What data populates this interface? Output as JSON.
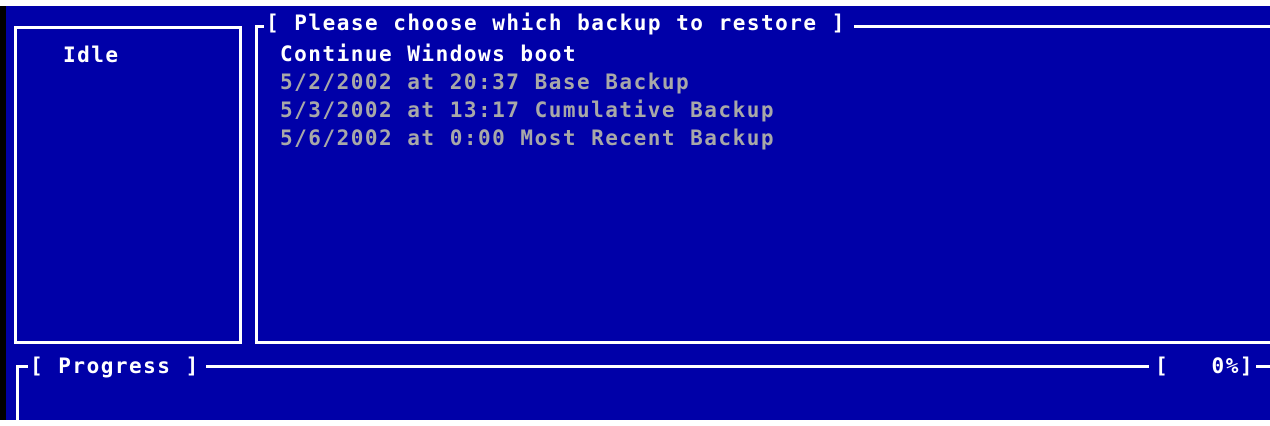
{
  "status": {
    "text": "Idle"
  },
  "restore": {
    "title": "[ Please choose which backup to restore ]",
    "options": [
      {
        "label": "Continue Windows boot",
        "selected": true
      },
      {
        "label": "5/2/2002 at 20:37 Base Backup",
        "selected": false
      },
      {
        "label": "5/3/2002 at 13:17 Cumulative Backup",
        "selected": false
      },
      {
        "label": "5/6/2002 at 0:00 Most Recent Backup",
        "selected": false
      }
    ]
  },
  "progress": {
    "label": "[ Progress ]",
    "percent_text": "[   0%]",
    "fraction": 0
  },
  "colors": {
    "background": "#0000a8",
    "highlight_text": "#ffffff",
    "normal_text": "#a8a8a8"
  }
}
